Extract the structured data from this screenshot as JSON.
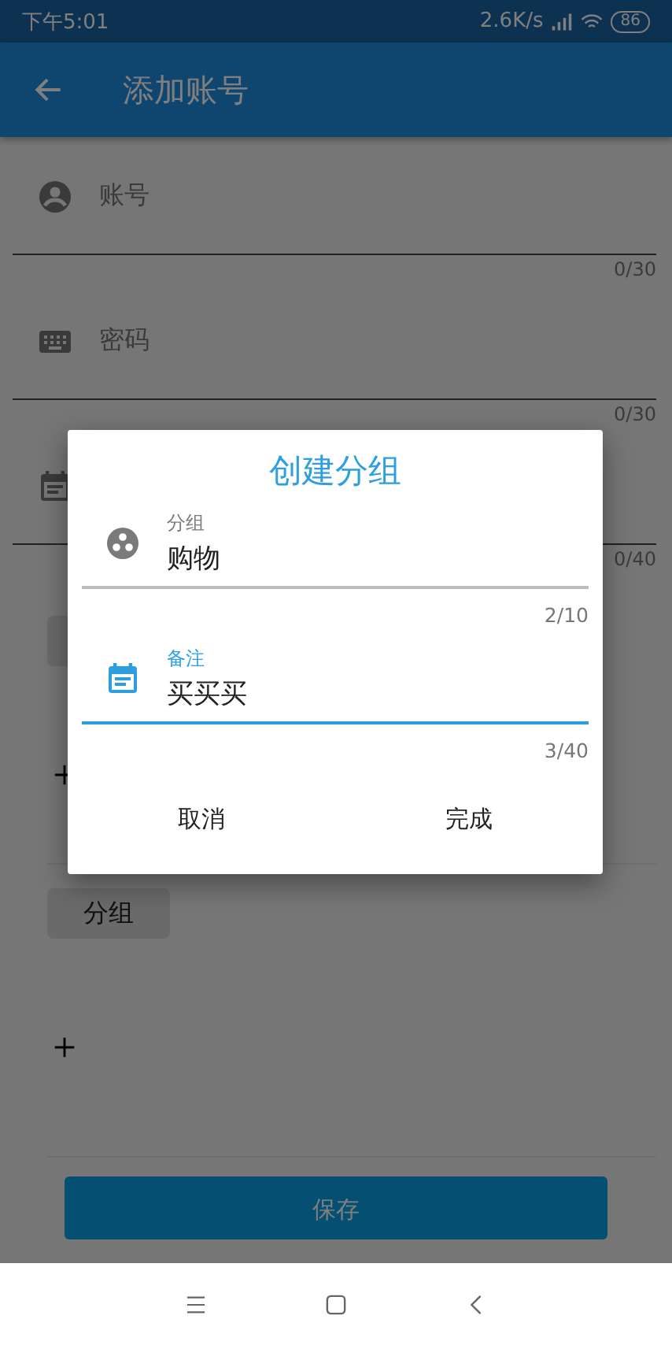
{
  "status_bar": {
    "time": "下午5:01",
    "speed": "2.6K/s",
    "battery": "86"
  },
  "app_bar": {
    "title": "添加账号"
  },
  "fields": [
    {
      "kind": "person",
      "placeholder": "账号",
      "counter": "0/30"
    },
    {
      "kind": "keyboard",
      "placeholder": "密码",
      "counter": "0/30"
    },
    {
      "kind": "calendar",
      "counter": "0/40"
    }
  ],
  "sections": [
    {
      "kind": "covered"
    },
    {
      "kind": "tag",
      "chip": "分组"
    }
  ],
  "save_button": "保存",
  "dialog": {
    "title": "创建分组",
    "fields": [
      {
        "kind": "group",
        "label": "分组",
        "value": "购物",
        "counter": "2/10",
        "focused": false
      },
      {
        "kind": "calendar",
        "label": "备注",
        "value": "买买买",
        "counter": "3/40",
        "focused": true
      }
    ],
    "buttons": [
      "取消",
      "完成"
    ]
  }
}
